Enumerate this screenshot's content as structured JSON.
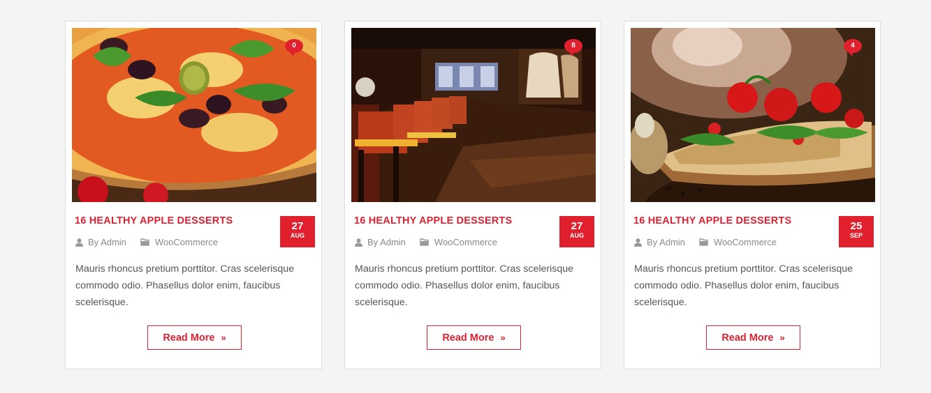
{
  "posts": [
    {
      "image_name": "pizza-olives-basil",
      "comments": "0",
      "title": "16 HEALTHY APPLE DESSERTS",
      "date_day": "27",
      "date_month": "AUG",
      "author": "By Admin",
      "category": "WooCommerce",
      "excerpt": "Mauris rhoncus pretium porttitor. Cras scelerisque commodo odio. Phasellus  dolor enim, faucibus scelerisque.",
      "read_more": "Read More"
    },
    {
      "image_name": "restaurant-bar-interior",
      "comments": "8",
      "title": "16 HEALTHY APPLE DESSERTS",
      "date_day": "27",
      "date_month": "AUG",
      "author": "By Admin",
      "category": "WooCommerce",
      "excerpt": "Mauris rhoncus pretium porttitor. Cras scelerisque commodo odio. Phasellus  dolor enim, faucibus scelerisque.",
      "read_more": "Read More"
    },
    {
      "image_name": "pizza-tomatoes-arugula",
      "comments": "4",
      "title": "16 HEALTHY APPLE DESSERTS",
      "date_day": "25",
      "date_month": "SEP",
      "author": "By Admin",
      "category": "WooCommerce",
      "excerpt": "Mauris rhoncus pretium porttitor. Cras scelerisque commodo odio. Phasellus  dolor enim, faucibus scelerisque.",
      "read_more": "Read More"
    }
  ],
  "colors": {
    "accent": "#e0202c",
    "page_bg": "#f4f4f4",
    "card_border": "#dddddd",
    "meta_text": "#888888",
    "body_text": "#555555"
  },
  "icons": {
    "author": "user-icon",
    "category": "folder-icon",
    "comments": "comment-bubble-icon",
    "read_more": "double-chevron-right-icon"
  }
}
